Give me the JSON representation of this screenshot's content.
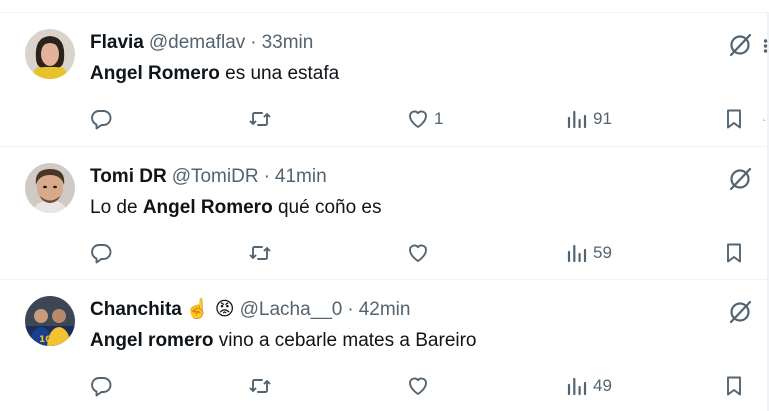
{
  "tweets": [
    {
      "name": "Flavia",
      "name_emoji": "",
      "handle": "@demaflav",
      "separator": "·",
      "time": "33min",
      "text_bold": "Angel Romero",
      "text_pre": "",
      "text_post": " es una estafa",
      "replies": "",
      "retweets": "",
      "likes": "1",
      "views": "91"
    },
    {
      "name": "Tomi DR",
      "name_emoji": "",
      "handle": "@TomiDR",
      "separator": "·",
      "time": "41min",
      "text_pre": "Lo de ",
      "text_bold": "Angel Romero",
      "text_post": " qué coño es",
      "replies": "",
      "retweets": "",
      "likes": "",
      "views": "59"
    },
    {
      "name": "Chanchita",
      "name_emoji": "☝️ 😡",
      "handle": "@Lacha__0",
      "separator": "·",
      "time": "42min",
      "text_pre": "",
      "text_bold": "Angel romero",
      "text_post": " vino a cebarle mates a Bareiro",
      "replies": "",
      "retweets": "",
      "likes": "",
      "views": "49"
    }
  ],
  "icons": {
    "reply": "reply-icon",
    "retweet": "retweet-icon",
    "like": "heart-icon",
    "views": "views-icon",
    "bookmark": "bookmark-icon",
    "grok": "grok-icon",
    "more": "more-icon"
  },
  "colors": {
    "text": "#0f1419",
    "secondary": "#536471",
    "divider": "#eff3f4"
  }
}
